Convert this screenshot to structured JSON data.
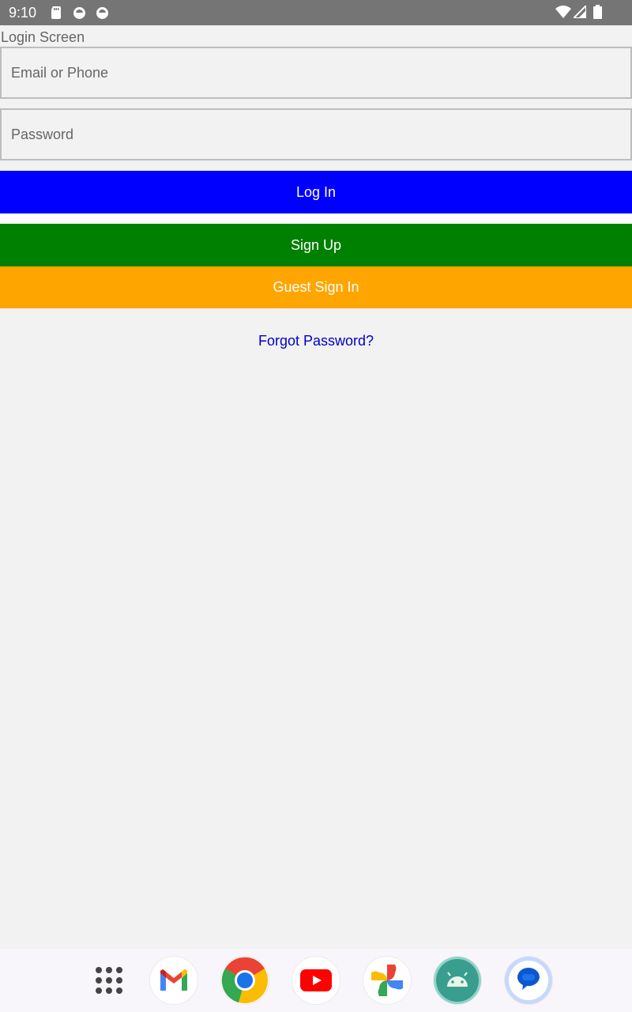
{
  "status_bar": {
    "time": "9:10",
    "left_icons": [
      "sd-card-icon",
      "sync-icon",
      "sync-icon"
    ],
    "right_icons": [
      "wifi-icon",
      "cell-signal-icon",
      "battery-icon"
    ]
  },
  "app": {
    "title": "Login Screen"
  },
  "form": {
    "email_placeholder": "Email or Phone",
    "password_placeholder": "Password",
    "login_label": "Log In",
    "signup_label": "Sign Up",
    "guest_label": "Guest Sign In",
    "forgot_label": "Forgot Password?"
  },
  "colors": {
    "login": "#0000ff",
    "signup": "#008000",
    "guest": "#ffa500",
    "link": "#0000cc",
    "status_bar": "#757575"
  },
  "dock": {
    "apps": [
      "app-drawer-icon",
      "gmail-icon",
      "chrome-icon",
      "youtube-icon",
      "photos-icon",
      "android-studio-icon",
      "messages-icon"
    ]
  }
}
